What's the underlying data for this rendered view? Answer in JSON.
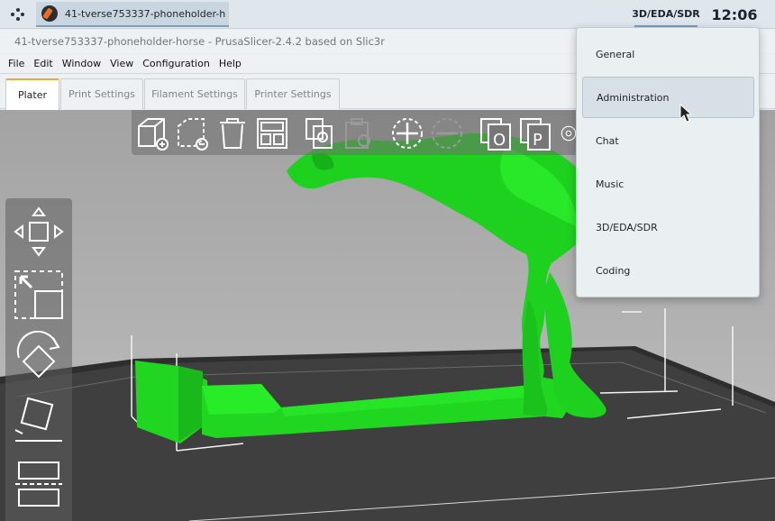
{
  "taskbar": {
    "launcher_icon": "app-launcher-icon",
    "task_label": "41-tverse753337-phoneholder-h...",
    "active_category": "3D/EDA/SDR",
    "clock": "12:06"
  },
  "window": {
    "title": "41-tverse753337-phoneholder-horse - PrusaSlicer-2.4.2 based on Slic3r"
  },
  "menu": [
    "File",
    "Edit",
    "Window",
    "View",
    "Configuration",
    "Help"
  ],
  "tabs": [
    "Plater",
    "Print Settings",
    "Filament Settings",
    "Printer Settings"
  ],
  "toolbar_icons": [
    "add-icon",
    "delete-icon",
    "delete-all-icon",
    "arrange-icon",
    "copy-icon",
    "paste-icon",
    "add-instance-icon",
    "remove-instance-icon",
    "split-objects-icon",
    "split-parts-icon",
    "layers-icon"
  ],
  "side_tools": [
    "move-icon",
    "scale-icon",
    "rotate-icon",
    "place-on-face-icon",
    "cut-icon"
  ],
  "dropdown": {
    "items": [
      "General",
      "Administration",
      "Chat",
      "Music",
      "3D/EDA/SDR",
      "Coding"
    ],
    "hovered": "Administration"
  },
  "colors": {
    "model": "#22dd22",
    "bed": "#3c3c3c",
    "accent_tab": "#f0a93b"
  }
}
